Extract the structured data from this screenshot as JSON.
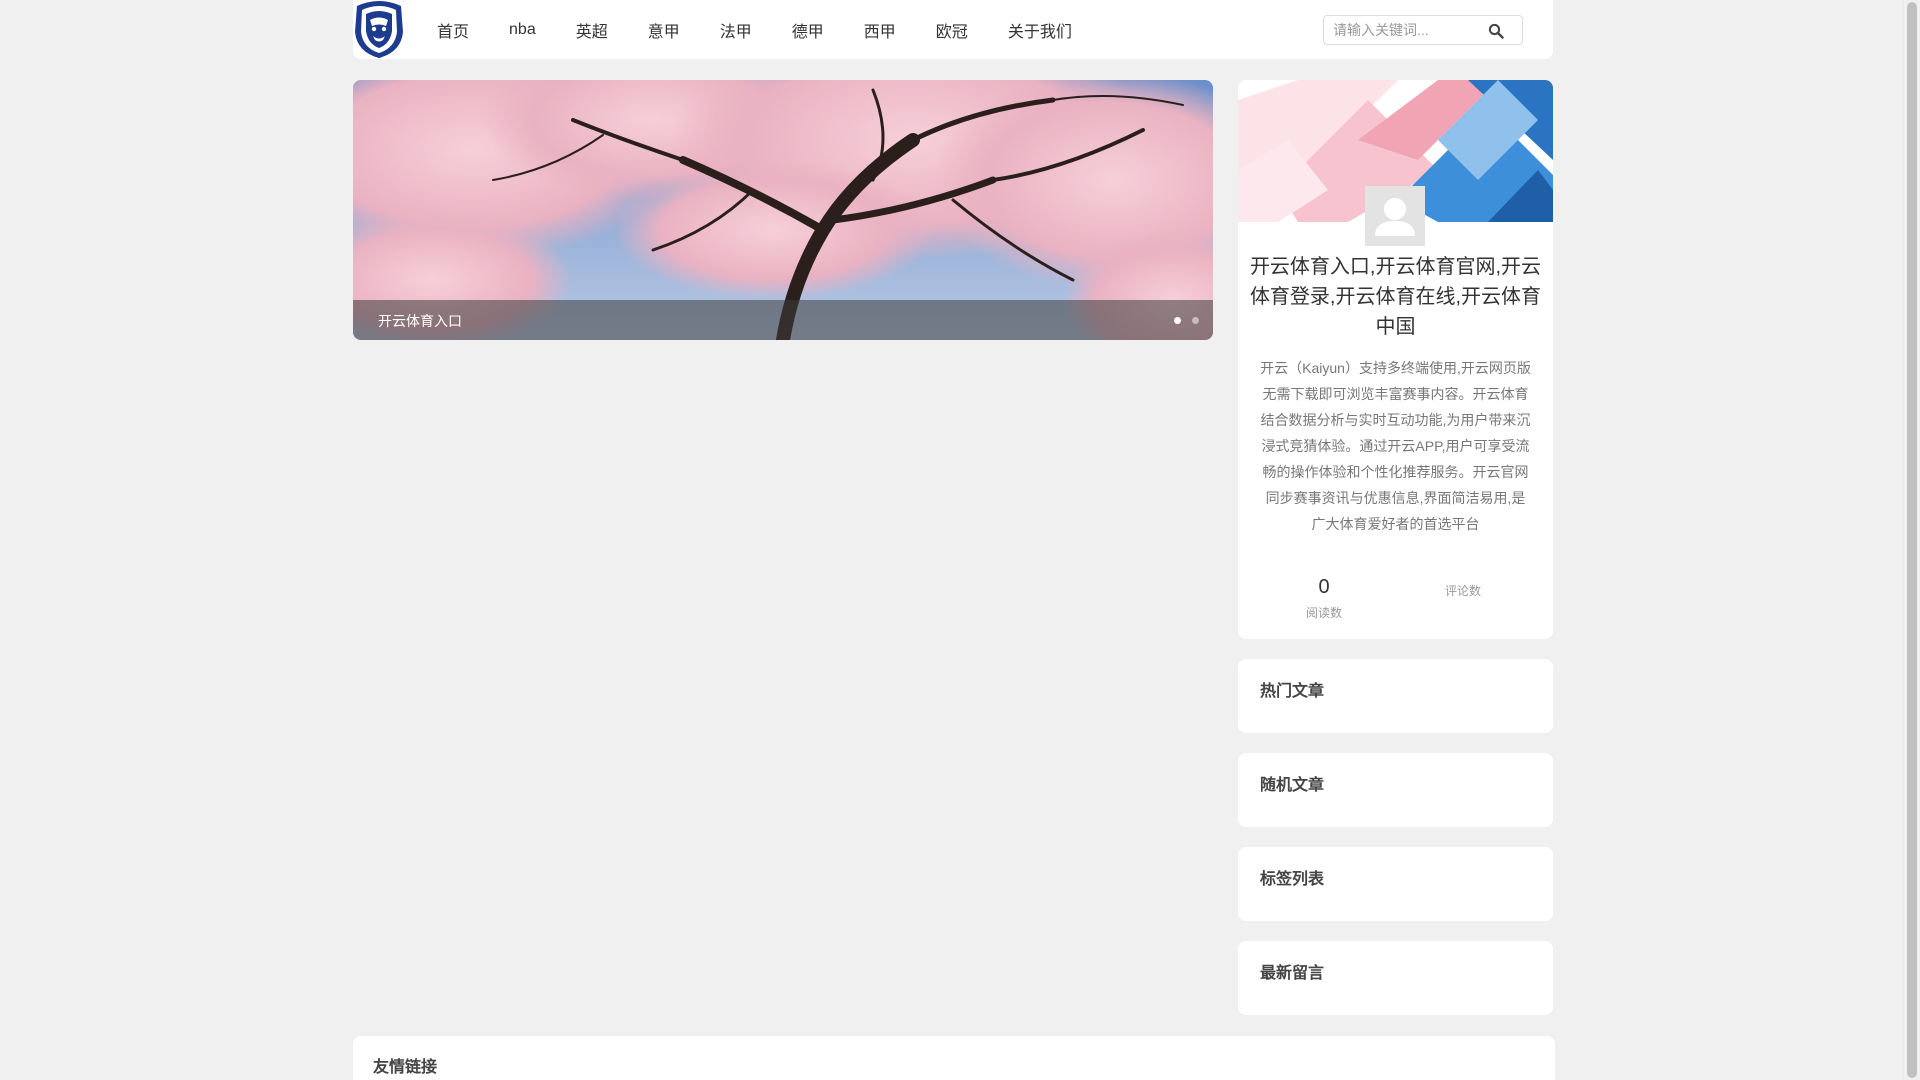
{
  "nav": {
    "items": [
      {
        "label": "首页"
      },
      {
        "label": "nba"
      },
      {
        "label": "英超"
      },
      {
        "label": "意甲"
      },
      {
        "label": "法甲"
      },
      {
        "label": "德甲"
      },
      {
        "label": "西甲"
      },
      {
        "label": "欧冠"
      },
      {
        "label": "关于我们"
      }
    ]
  },
  "search": {
    "placeholder": "请输入关键词..."
  },
  "banner": {
    "caption": "开云体育入口",
    "slide_count": 2,
    "active_slide": 1
  },
  "profile": {
    "title": "开云体育入口,开云体育官网,开云体育登录,开云体育在线,开云体育中国",
    "description": "开云（Kaiyun）支持多终端使用,开云网页版无需下载即可浏览丰富赛事内容。开云体育结合数据分析与实时互动功能,为用户带来沉浸式竞猜体验。通过开云APP,用户可享受流畅的操作体验和个性化推荐服务。开云官网同步赛事资讯与优惠信息,界面简洁易用,是广大体育爱好者的首选平台",
    "views_count": "0",
    "views_label": "阅读数",
    "comments_label": "评论数"
  },
  "widgets": [
    {
      "title": "热门文章"
    },
    {
      "title": "随机文章"
    },
    {
      "title": "标签列表"
    },
    {
      "title": "最新留言"
    }
  ],
  "footer": {
    "links_title": "友情链接"
  },
  "colors": {
    "brand": "#1d3b8f",
    "background": "#f0f0f0",
    "card": "#ffffff"
  }
}
